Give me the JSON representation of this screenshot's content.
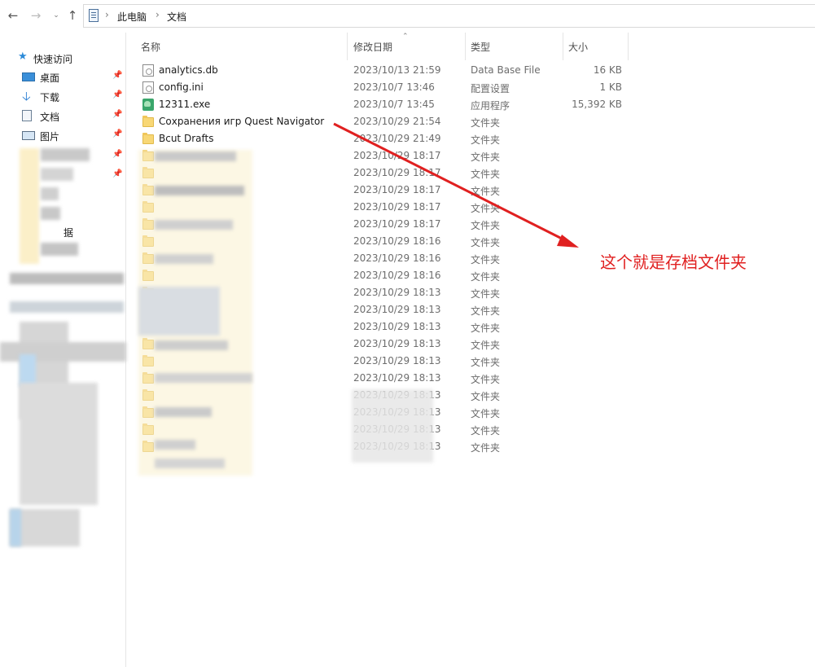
{
  "address_bar": {
    "breadcrumb": [
      "此电脑",
      "文档"
    ]
  },
  "sidebar": {
    "quick_access_label": "快速访问",
    "items": [
      {
        "label": "桌面",
        "icon": "desktop-icon",
        "pinned": true
      },
      {
        "label": "下载",
        "icon": "download-icon",
        "pinned": true
      },
      {
        "label": "文档",
        "icon": "documents-icon",
        "pinned": true
      },
      {
        "label": "图片",
        "icon": "pictures-icon",
        "pinned": true
      }
    ],
    "partial_label": "据"
  },
  "columns": {
    "name": "名称",
    "date": "修改日期",
    "type": "类型",
    "size": "大小"
  },
  "files": [
    {
      "name": "analytics.db",
      "date": "2023/10/13 21:59",
      "type": "Data Base File",
      "size": "16 KB",
      "icon": "database-file-icon"
    },
    {
      "name": "config.ini",
      "date": "2023/10/7 13:46",
      "type": "配置设置",
      "size": "1 KB",
      "icon": "settings-file-icon"
    },
    {
      "name": "12311.exe",
      "date": "2023/10/7 13:45",
      "type": "应用程序",
      "size": "15,392 KB",
      "icon": "application-icon"
    },
    {
      "name": "Сохранения игр Quest Navigator",
      "date": "2023/10/29 21:54",
      "type": "文件夹",
      "size": "",
      "icon": "folder-icon"
    },
    {
      "name": "Bcut Drafts",
      "date": "2023/10/29 21:49",
      "type": "文件夹",
      "size": "",
      "icon": "folder-icon"
    },
    {
      "name": "",
      "date": "2023/10/29 18:17",
      "type": "文件夹",
      "size": "",
      "icon": "folder-icon"
    },
    {
      "name": "",
      "date": "2023/10/29 18:17",
      "type": "文件夹",
      "size": "",
      "icon": "folder-icon"
    },
    {
      "name": "",
      "date": "2023/10/29 18:17",
      "type": "文件夹",
      "size": "",
      "icon": "folder-icon"
    },
    {
      "name": "",
      "date": "2023/10/29 18:17",
      "type": "文件夹",
      "size": "",
      "icon": "folder-icon"
    },
    {
      "name": "",
      "date": "2023/10/29 18:17",
      "type": "文件夹",
      "size": "",
      "icon": "folder-icon"
    },
    {
      "name": "",
      "date": "2023/10/29 18:16",
      "type": "文件夹",
      "size": "",
      "icon": "folder-icon"
    },
    {
      "name": "",
      "date": "2023/10/29 18:16",
      "type": "文件夹",
      "size": "",
      "icon": "folder-icon"
    },
    {
      "name": "",
      "date": "2023/10/29 18:16",
      "type": "文件夹",
      "size": "",
      "icon": "folder-icon"
    },
    {
      "name": "",
      "date": "2023/10/29 18:13",
      "type": "文件夹",
      "size": "",
      "icon": "folder-icon"
    },
    {
      "name": "",
      "date": "2023/10/29 18:13",
      "type": "文件夹",
      "size": "",
      "icon": "folder-icon"
    },
    {
      "name": "",
      "date": "2023/10/29 18:13",
      "type": "文件夹",
      "size": "",
      "icon": "folder-icon"
    },
    {
      "name": "",
      "date": "2023/10/29 18:13",
      "type": "文件夹",
      "size": "",
      "icon": "folder-icon"
    },
    {
      "name": "",
      "date": "2023/10/29 18:13",
      "type": "文件夹",
      "size": "",
      "icon": "folder-icon"
    },
    {
      "name": "",
      "date": "2023/10/29 18:13",
      "type": "文件夹",
      "size": "",
      "icon": "folder-icon"
    },
    {
      "name": "",
      "date": "2023/10/29 18:13",
      "type": "文件夹",
      "size": "",
      "icon": "folder-icon"
    },
    {
      "name": "",
      "date": "2023/10/29 18:13",
      "type": "文件夹",
      "size": "",
      "icon": "folder-icon"
    },
    {
      "name": "",
      "date": "2023/10/29 18:13",
      "type": "文件夹",
      "size": "",
      "icon": "folder-icon"
    },
    {
      "name": "",
      "date": "2023/10/29 18:13",
      "type": "文件夹",
      "size": "",
      "icon": "folder-icon"
    }
  ],
  "annotation": {
    "text": "这个就是存档文件夹",
    "color": "#e02020"
  }
}
